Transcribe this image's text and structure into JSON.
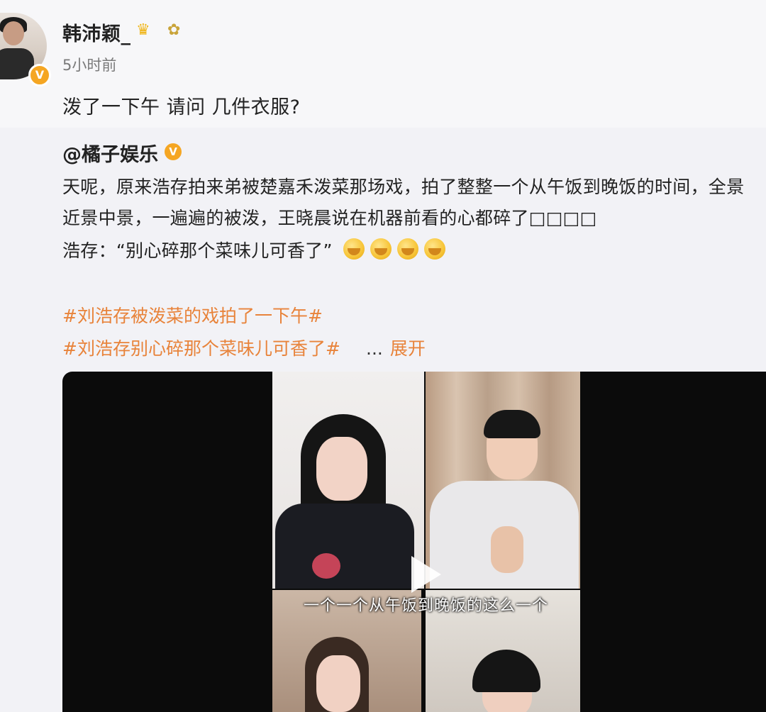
{
  "post": {
    "username": "韩沛颖_",
    "timestamp": "5小时前",
    "text": "泼了一下午 请问 几件衣服?"
  },
  "repost": {
    "username": "@橘子娱乐",
    "lines": [
      "天呢，原来浩存拍来弟被楚嘉禾泼菜那场戏，拍了整整一个从午饭到晚饭的时间，全景",
      "近景中景，一遍遍的被泼，王晓晨说在机器前看的心都碎了□□□□",
      "浩存：“别心碎那个菜味儿可香了”"
    ],
    "hashtags": [
      "#刘浩存被泼菜的戏拍了一下午#",
      "#刘浩存别心碎那个菜味儿可香了#"
    ],
    "expand_dots": "...",
    "expand_label": "展开"
  },
  "video": {
    "subtitle": "一个一个从午饭到晚饭的这么一个"
  },
  "icons": {
    "verified": "verified-icon",
    "crown": "crown-icon",
    "flower": "flower-icon",
    "emoji": "pray-emoji-icon",
    "play": "play-icon"
  },
  "colors": {
    "accent": "#e8833a",
    "verified": "#f5a623"
  }
}
